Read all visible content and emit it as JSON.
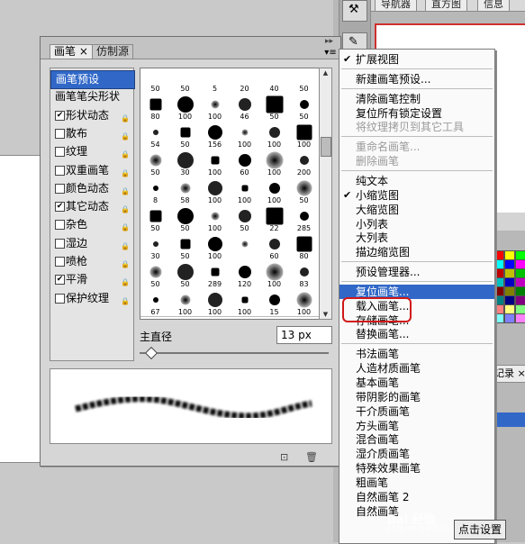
{
  "brush_panel": {
    "tabs": [
      "画笔",
      "仿制源"
    ],
    "tab_close": "×",
    "options": [
      {
        "label": "画笔预设",
        "checkbox": false,
        "checked": false,
        "lock": false,
        "selected": true
      },
      {
        "label": "画笔笔尖形状",
        "checkbox": false,
        "checked": false,
        "lock": false
      },
      {
        "label": "形状动态",
        "checkbox": true,
        "checked": true,
        "lock": true
      },
      {
        "label": "散布",
        "checkbox": true,
        "checked": false,
        "lock": true
      },
      {
        "label": "纹理",
        "checkbox": true,
        "checked": false,
        "lock": true
      },
      {
        "label": "双重画笔",
        "checkbox": true,
        "checked": false,
        "lock": true
      },
      {
        "label": "颜色动态",
        "checkbox": true,
        "checked": false,
        "lock": true
      },
      {
        "label": "其它动态",
        "checkbox": true,
        "checked": true,
        "lock": true
      },
      {
        "label": "杂色",
        "checkbox": true,
        "checked": false,
        "lock": true
      },
      {
        "label": "湿边",
        "checkbox": true,
        "checked": false,
        "lock": true
      },
      {
        "label": "喷枪",
        "checkbox": true,
        "checked": false,
        "lock": true
      },
      {
        "label": "平滑",
        "checkbox": true,
        "checked": true,
        "lock": true
      },
      {
        "label": "保护纹理",
        "checkbox": true,
        "checked": false,
        "lock": true
      }
    ],
    "brush_sizes": [
      [
        "50",
        "50",
        "5",
        "20",
        "40",
        "50"
      ],
      [
        "80",
        "100",
        "100",
        "46",
        "50",
        "50"
      ],
      [
        "54",
        "50",
        "156",
        "100",
        "100",
        "100"
      ],
      [
        "50",
        "30",
        "100",
        "60",
        "100",
        "200"
      ],
      [
        "8",
        "58",
        "100",
        "100",
        "100",
        "50"
      ],
      [
        "50",
        "50",
        "100",
        "50",
        "22",
        "285"
      ],
      [
        "30",
        "50",
        "100",
        "",
        "60",
        "80"
      ],
      [
        "50",
        "50",
        "289",
        "120",
        "100",
        "83"
      ],
      [
        "67",
        "100",
        "100",
        "100",
        "15",
        "100"
      ]
    ],
    "diameter_label": "主直径",
    "diameter_value": "13 px",
    "diameter_fraction": 0.04
  },
  "menu": {
    "items": [
      {
        "label": "扩展视图",
        "check": "✔",
        "disabled": false
      },
      {
        "sep": true
      },
      {
        "label": "新建画笔预设...",
        "disabled": false
      },
      {
        "sep": true
      },
      {
        "label": "清除画笔控制",
        "disabled": false
      },
      {
        "label": "复位所有锁定设置",
        "disabled": false
      },
      {
        "label": "将纹理拷贝到其它工具",
        "disabled": true
      },
      {
        "sep": true
      },
      {
        "label": "重命名画笔...",
        "disabled": true
      },
      {
        "label": "删除画笔",
        "disabled": true
      },
      {
        "sep": true
      },
      {
        "label": "纯文本",
        "disabled": false
      },
      {
        "label": "小缩览图",
        "check": "✔",
        "disabled": false
      },
      {
        "label": "大缩览图",
        "disabled": false
      },
      {
        "label": "小列表",
        "disabled": false
      },
      {
        "label": "大列表",
        "disabled": false
      },
      {
        "label": "描边缩览图",
        "disabled": false
      },
      {
        "sep": true
      },
      {
        "label": "预设管理器...",
        "disabled": false
      },
      {
        "sep": true
      },
      {
        "label": "复位画笔...",
        "disabled": false,
        "highlighted": true
      },
      {
        "label": "载入画笔...",
        "disabled": false
      },
      {
        "label": "存储画笔...",
        "disabled": false
      },
      {
        "label": "替换画笔...",
        "disabled": false
      },
      {
        "sep": true
      },
      {
        "label": "书法画笔",
        "disabled": false
      },
      {
        "label": "人造材质画笔",
        "disabled": false
      },
      {
        "label": "基本画笔",
        "disabled": false
      },
      {
        "label": "带阴影的画笔",
        "disabled": false
      },
      {
        "label": "干介质画笔",
        "disabled": false
      },
      {
        "label": "方头画笔",
        "disabled": false
      },
      {
        "label": "混合画笔",
        "disabled": false
      },
      {
        "label": "湿介质画笔",
        "disabled": false
      },
      {
        "label": "特殊效果画笔",
        "disabled": false
      },
      {
        "label": "粗画笔",
        "disabled": false
      },
      {
        "label": "自然画笔 2",
        "disabled": false
      },
      {
        "label": "自然画笔",
        "disabled": false
      }
    ]
  },
  "background": {
    "navigator_tabs": [
      "导航器",
      "直方图",
      "信息"
    ],
    "history_tab": "记录 ×"
  },
  "watermark": {
    "logo": "Bai 经验",
    "url": "jingyan.baidu.com"
  },
  "click_button": "点击设置",
  "colors": {
    "accent": "#3168c8",
    "highlight_circle": "#d01818"
  }
}
